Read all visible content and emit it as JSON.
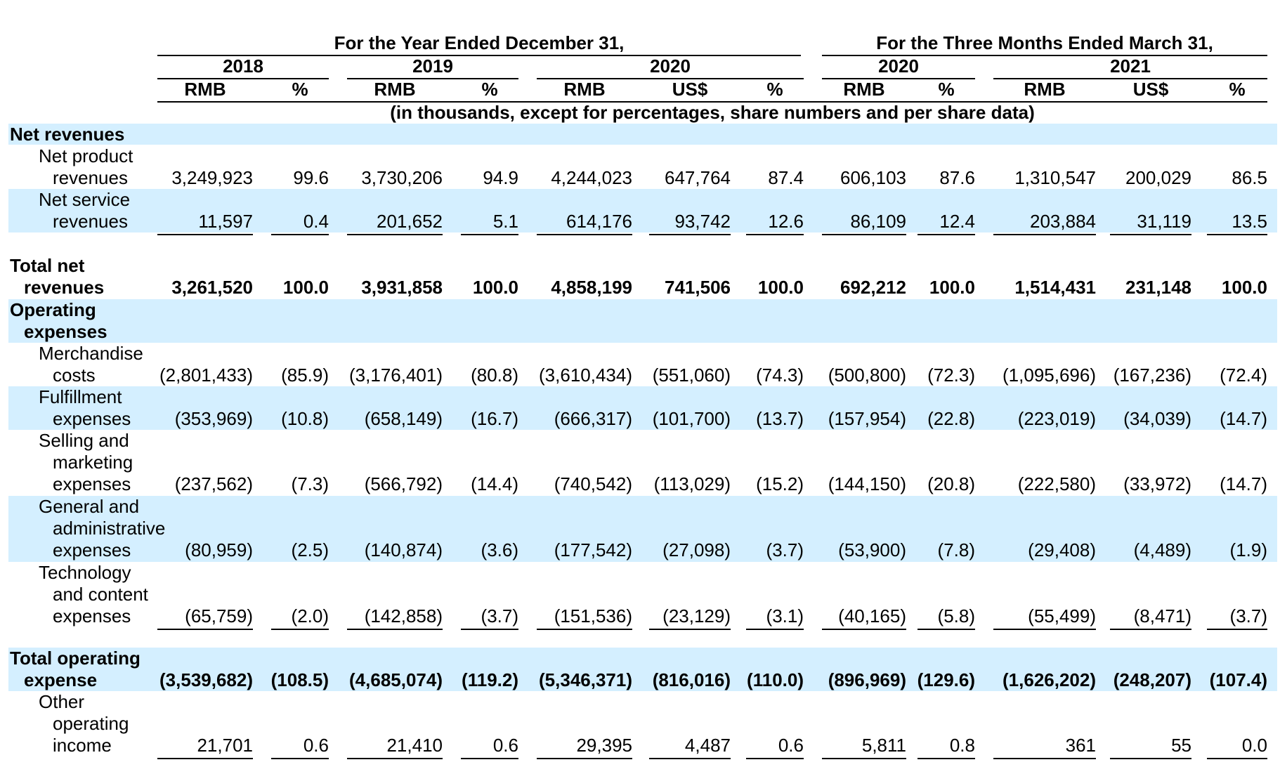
{
  "header": {
    "group_year": "For the Year Ended December 31,",
    "group_quarter": "For the Three Months Ended March 31,",
    "years": [
      "2018",
      "2019",
      "2020",
      "2020",
      "2021"
    ],
    "columns": [
      "RMB",
      "%",
      "RMB",
      "%",
      "RMB",
      "US$",
      "%",
      "RMB",
      "%",
      "RMB",
      "US$",
      "%"
    ],
    "units_note": "(in thousands, except for percentages, share numbers and per share data)"
  },
  "sections": {
    "net_revenues": "Net revenues",
    "operating_expenses": [
      "Operating",
      "expenses"
    ]
  },
  "rows": [
    {
      "label": [
        "Net product",
        "revenues"
      ],
      "values": [
        "3,249,923",
        "99.6",
        "3,730,206",
        "94.9",
        "4,244,023",
        "647,764",
        "87.4",
        "606,103",
        "87.6",
        "1,310,547",
        "200,029",
        "86.5"
      ]
    },
    {
      "label": [
        "Net service",
        "revenues"
      ],
      "values": [
        "11,597",
        "0.4",
        "201,652",
        "5.1",
        "614,176",
        "93,742",
        "12.6",
        "86,109",
        "12.4",
        "203,884",
        "31,119",
        "13.5"
      ]
    },
    {
      "label": [
        "Total net",
        "revenues"
      ],
      "values": [
        "3,261,520",
        "100.0",
        "3,931,858",
        "100.0",
        "4,858,199",
        "741,506",
        "100.0",
        "692,212",
        "100.0",
        "1,514,431",
        "231,148",
        "100.0"
      ]
    },
    {
      "label": [
        "Merchandise",
        "costs"
      ],
      "values": [
        "(2,801,433)",
        "(85.9)",
        "(3,176,401)",
        "(80.8)",
        "(3,610,434)",
        "(551,060)",
        "(74.3)",
        "(500,800)",
        "(72.3)",
        "(1,095,696)",
        "(167,236)",
        "(72.4)"
      ]
    },
    {
      "label": [
        "Fulfillment",
        "expenses"
      ],
      "values": [
        "(353,969)",
        "(10.8)",
        "(658,149)",
        "(16.7)",
        "(666,317)",
        "(101,700)",
        "(13.7)",
        "(157,954)",
        "(22.8)",
        "(223,019)",
        "(34,039)",
        "(14.7)"
      ]
    },
    {
      "label": [
        "Selling and",
        "marketing",
        "expenses"
      ],
      "values": [
        "(237,562)",
        "(7.3)",
        "(566,792)",
        "(14.4)",
        "(740,542)",
        "(113,029)",
        "(15.2)",
        "(144,150)",
        "(20.8)",
        "(222,580)",
        "(33,972)",
        "(14.7)"
      ]
    },
    {
      "label": [
        "General and",
        "administrative",
        "expenses"
      ],
      "values": [
        "(80,959)",
        "(2.5)",
        "(140,874)",
        "(3.6)",
        "(177,542)",
        "(27,098)",
        "(3.7)",
        "(53,900)",
        "(7.8)",
        "(29,408)",
        "(4,489)",
        "(1.9)"
      ]
    },
    {
      "label": [
        "Technology",
        "and content",
        "expenses"
      ],
      "values": [
        "(65,759)",
        "(2.0)",
        "(142,858)",
        "(3.7)",
        "(151,536)",
        "(23,129)",
        "(3.1)",
        "(40,165)",
        "(5.8)",
        "(55,499)",
        "(8,471)",
        "(3.7)"
      ]
    },
    {
      "label": [
        "Total operating",
        "expense"
      ],
      "values": [
        "(3,539,682)",
        "(108.5)",
        "(4,685,074)",
        "(119.2)",
        "(5,346,371)",
        "(816,016)",
        "(110.0)",
        "(896,969)",
        "(129.6)",
        "(1,626,202)",
        "(248,207)",
        "(107.4)"
      ]
    },
    {
      "label": [
        "Other",
        "operating",
        "income"
      ],
      "values": [
        "21,701",
        "0.6",
        "21,410",
        "0.6",
        "29,395",
        "4,487",
        "0.6",
        "5,811",
        "0.8",
        "361",
        "55",
        "0.0"
      ]
    }
  ]
}
